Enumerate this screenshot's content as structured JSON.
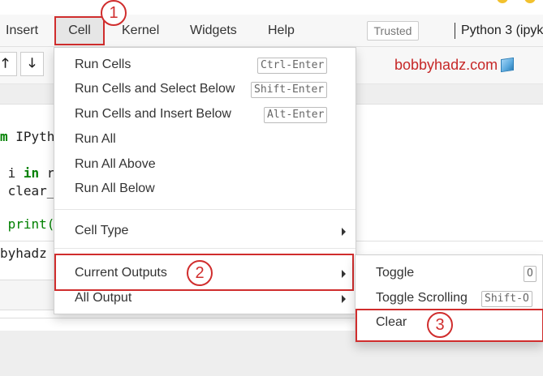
{
  "menubar": {
    "items": [
      "Insert",
      "Cell",
      "Kernel",
      "Widgets",
      "Help"
    ],
    "trusted": "Trusted",
    "kernel": "Python 3 (ipyk"
  },
  "toolbar": {
    "up_icon": "arrow-up-icon",
    "down_icon": "arrow-down-icon",
    "up_glyph": "🡑",
    "down_glyph": "🡓",
    "brand": "bobbyhadz.com",
    "brand_color": "#c62828",
    "brand_icon": "cube-icon"
  },
  "code": {
    "line1_kw": "m",
    "line1_rest": " IPyth",
    "line2_var": " i ",
    "line2_kw": "in",
    "line2_rest": " r",
    "line3": " clear_",
    "line4": " print(",
    "output": "byhadz"
  },
  "cell_menu": {
    "items": [
      {
        "label": "Run Cells",
        "shortcut": "Ctrl-Enter"
      },
      {
        "label": "Run Cells and Select Below",
        "shortcut": "Shift-Enter"
      },
      {
        "label": "Run Cells and Insert Below",
        "shortcut": "Alt-Enter"
      },
      {
        "label": "Run All"
      },
      {
        "label": "Run All Above"
      },
      {
        "label": "Run All Below"
      }
    ],
    "cell_type": "Cell Type",
    "current_outputs": "Current Outputs",
    "all_output": "All Output"
  },
  "outputs_submenu": {
    "toggle": "Toggle",
    "toggle_shortcut": "O",
    "toggle_scrolling": "Toggle Scrolling",
    "toggle_scrolling_shortcut": "Shift-O",
    "clear": "Clear"
  },
  "annotations": {
    "step1": "1",
    "step2": "2",
    "step3": "3",
    "highlight_color": "#d02d2d"
  }
}
